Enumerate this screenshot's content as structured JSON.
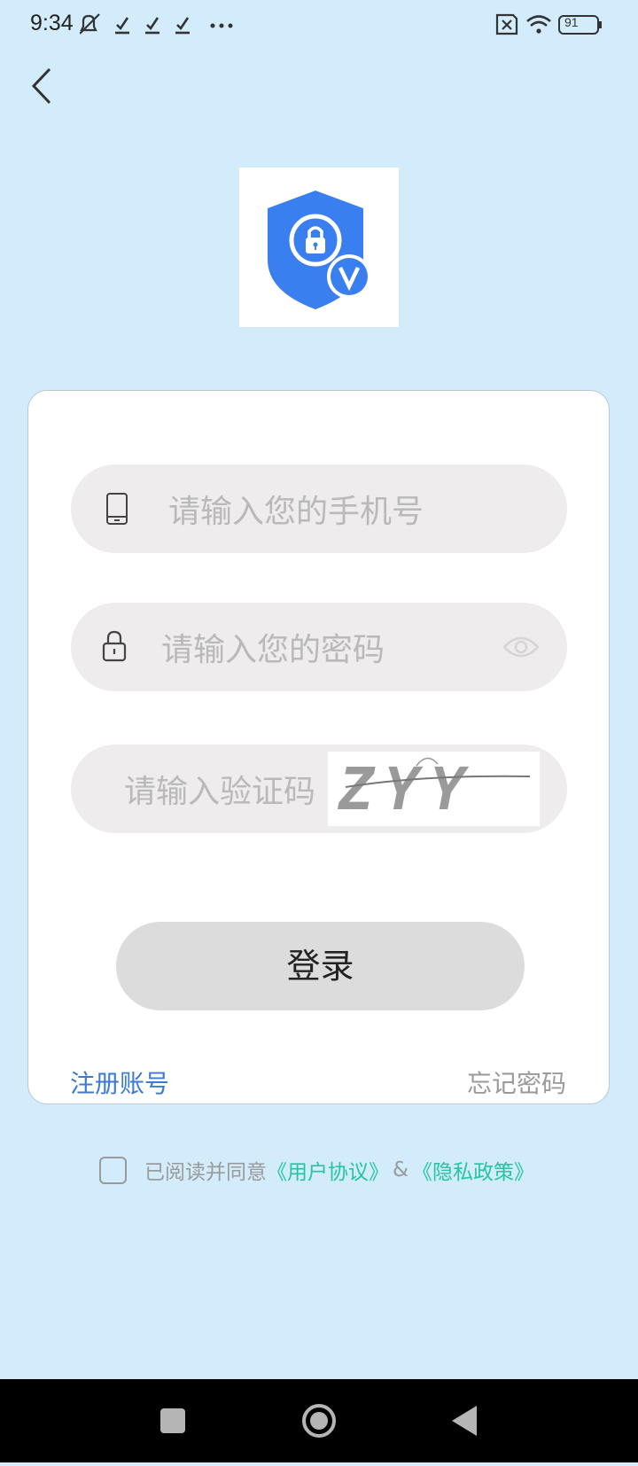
{
  "status_bar": {
    "time": "9:34",
    "battery": "91",
    "icons": [
      "bell-off-icon",
      "check-icon",
      "check-icon",
      "check-icon",
      "more-icon",
      "sim-off-icon",
      "wifi-icon",
      "battery-icon"
    ]
  },
  "header": {
    "back_icon": "chevron-left-icon"
  },
  "logo": {
    "icon": "shield-lock-verified-icon"
  },
  "form": {
    "phone_placeholder": "请输入您的手机号",
    "password_placeholder": "请输入您的密码",
    "captcha_placeholder": "请输入验证码",
    "captcha_text": "ZYY",
    "login_label": "登录",
    "register_label": "注册账号",
    "forgot_label": "忘记密码"
  },
  "agreement": {
    "prefix": "已阅读并同意",
    "user_agreement": "《用户协议》",
    "amp": "&",
    "privacy_policy": "《隐私政策》"
  },
  "colors": {
    "background": "#d2ecfc",
    "link_blue": "#3d7ad6",
    "link_green": "#26c4a0",
    "shield_blue": "#3a7ff0"
  }
}
